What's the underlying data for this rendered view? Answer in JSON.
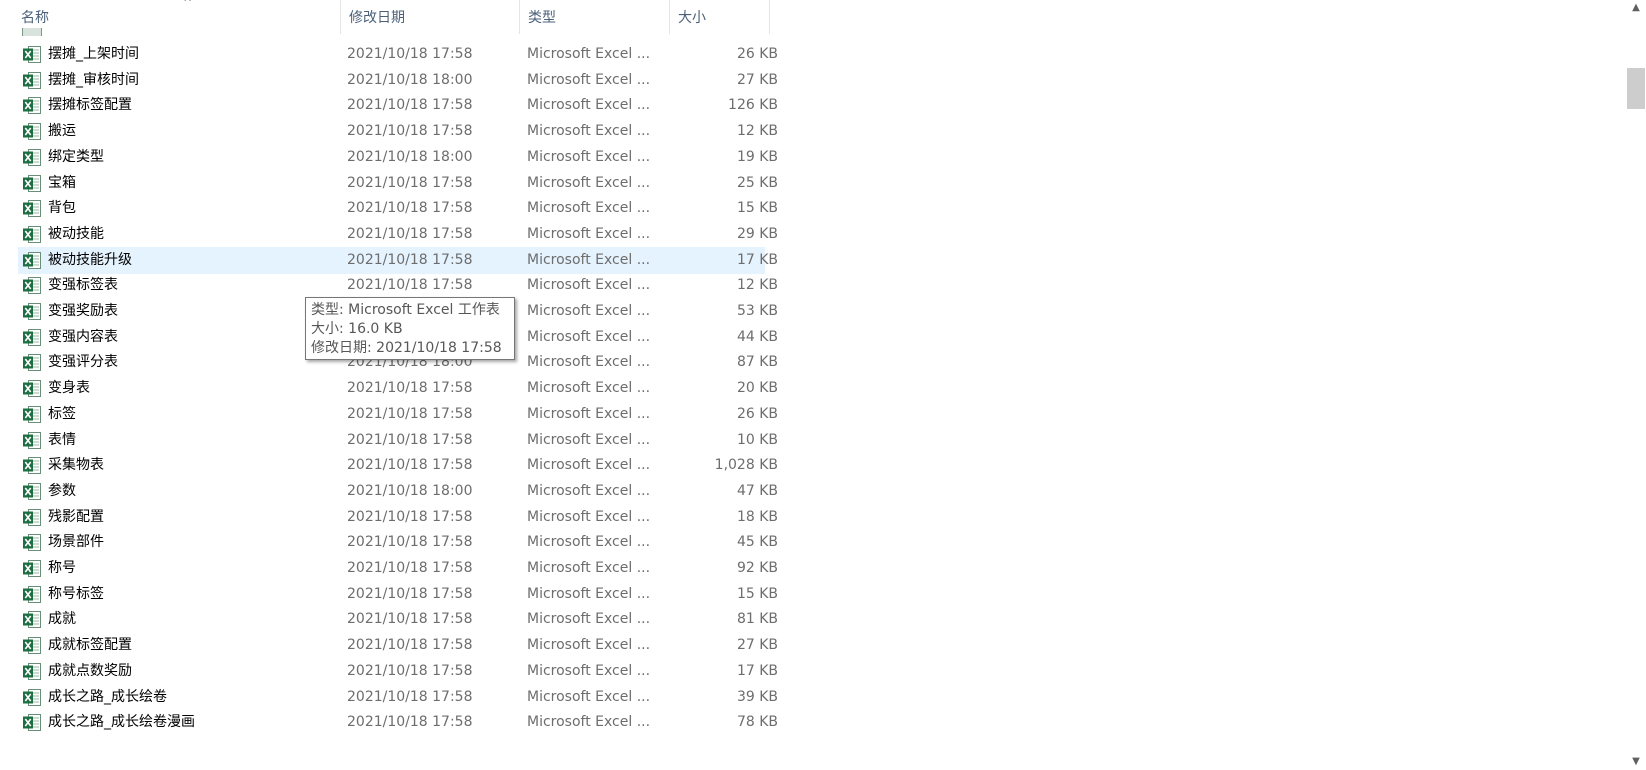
{
  "columns": {
    "name": "名称",
    "date": "修改日期",
    "type": "类型",
    "size": "大小",
    "sort_indicator": "^"
  },
  "icons": {
    "file": "excel-file-icon",
    "excel_green": "#1d6f42"
  },
  "colors": {
    "hover_row": "#e5f3ff",
    "header_text": "#4c607a",
    "meta_text": "#6d6d6d"
  },
  "rows": [
    {
      "name": "摆摊_上架时间",
      "date": "2021/10/18 17:58",
      "type": "Microsoft Excel ...",
      "size": "26 KB"
    },
    {
      "name": "摆摊_审核时间",
      "date": "2021/10/18 18:00",
      "type": "Microsoft Excel ...",
      "size": "27 KB"
    },
    {
      "name": "摆摊标签配置",
      "date": "2021/10/18 17:58",
      "type": "Microsoft Excel ...",
      "size": "126 KB"
    },
    {
      "name": "搬运",
      "date": "2021/10/18 17:58",
      "type": "Microsoft Excel ...",
      "size": "12 KB"
    },
    {
      "name": "绑定类型",
      "date": "2021/10/18 18:00",
      "type": "Microsoft Excel ...",
      "size": "19 KB"
    },
    {
      "name": "宝箱",
      "date": "2021/10/18 17:58",
      "type": "Microsoft Excel ...",
      "size": "25 KB"
    },
    {
      "name": "背包",
      "date": "2021/10/18 17:58",
      "type": "Microsoft Excel ...",
      "size": "15 KB"
    },
    {
      "name": "被动技能",
      "date": "2021/10/18 17:58",
      "type": "Microsoft Excel ...",
      "size": "29 KB"
    },
    {
      "name": "被动技能升级",
      "date": "2021/10/18 17:58",
      "type": "Microsoft Excel ...",
      "size": "17 KB",
      "hover": true
    },
    {
      "name": "变强标签表",
      "date": "2021/10/18 17:58",
      "type": "Microsoft Excel ...",
      "size": "12 KB"
    },
    {
      "name": "变强奖励表",
      "date": "",
      "type": "Microsoft Excel ...",
      "size": "53 KB"
    },
    {
      "name": "变强内容表",
      "date": "",
      "type": "Microsoft Excel ...",
      "size": "44 KB"
    },
    {
      "name": "变强评分表",
      "date": "2021/10/18 18:00",
      "type": "Microsoft Excel ...",
      "size": "87 KB"
    },
    {
      "name": "变身表",
      "date": "2021/10/18 17:58",
      "type": "Microsoft Excel ...",
      "size": "20 KB"
    },
    {
      "name": "标签",
      "date": "2021/10/18 17:58",
      "type": "Microsoft Excel ...",
      "size": "26 KB"
    },
    {
      "name": "表情",
      "date": "2021/10/18 17:58",
      "type": "Microsoft Excel ...",
      "size": "10 KB"
    },
    {
      "name": "采集物表",
      "date": "2021/10/18 17:58",
      "type": "Microsoft Excel ...",
      "size": "1,028 KB"
    },
    {
      "name": "参数",
      "date": "2021/10/18 18:00",
      "type": "Microsoft Excel ...",
      "size": "47 KB"
    },
    {
      "name": "残影配置",
      "date": "2021/10/18 17:58",
      "type": "Microsoft Excel ...",
      "size": "18 KB"
    },
    {
      "name": "场景部件",
      "date": "2021/10/18 17:58",
      "type": "Microsoft Excel ...",
      "size": "45 KB"
    },
    {
      "name": "称号",
      "date": "2021/10/18 17:58",
      "type": "Microsoft Excel ...",
      "size": "92 KB"
    },
    {
      "name": "称号标签",
      "date": "2021/10/18 17:58",
      "type": "Microsoft Excel ...",
      "size": "15 KB"
    },
    {
      "name": "成就",
      "date": "2021/10/18 17:58",
      "type": "Microsoft Excel ...",
      "size": "81 KB"
    },
    {
      "name": "成就标签配置",
      "date": "2021/10/18 17:58",
      "type": "Microsoft Excel ...",
      "size": "27 KB"
    },
    {
      "name": "成就点数奖励",
      "date": "2021/10/18 17:58",
      "type": "Microsoft Excel ...",
      "size": "17 KB"
    },
    {
      "name": "成长之路_成长绘卷",
      "date": "2021/10/18 17:58",
      "type": "Microsoft Excel ...",
      "size": "39 KB"
    },
    {
      "name": "成长之路_成长绘卷漫画",
      "date": "2021/10/18 17:58",
      "type": "Microsoft Excel ...",
      "size": "78 KB"
    }
  ],
  "tooltip": {
    "type_line": "类型: Microsoft Excel 工作表",
    "size_line": "大小: 16.0 KB",
    "date_line": "修改日期: 2021/10/18 17:58"
  },
  "scrollbar": {
    "up_arrow": "▲",
    "down_arrow": "▼"
  }
}
